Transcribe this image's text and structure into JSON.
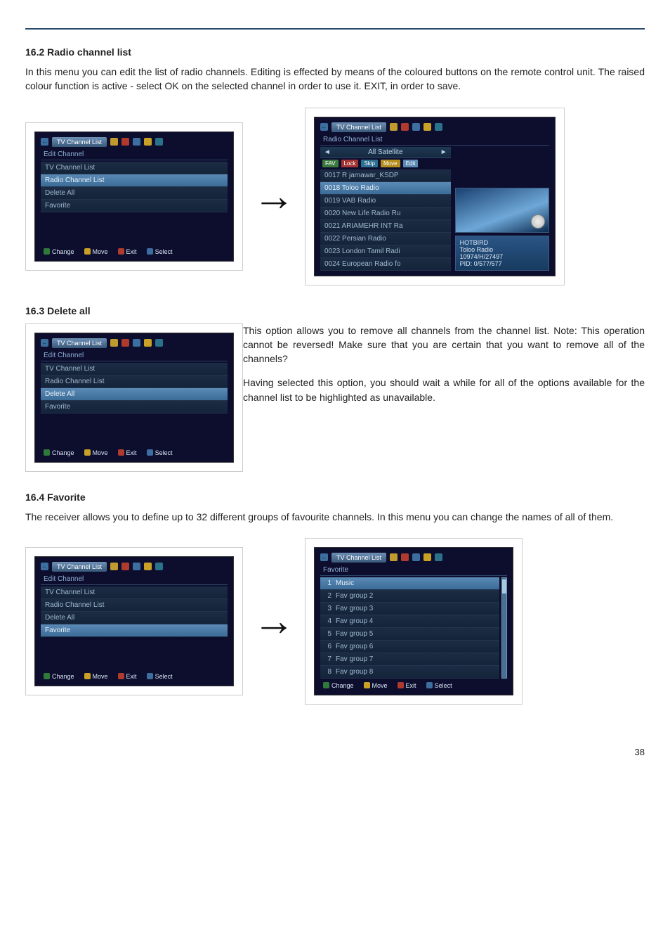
{
  "page_number": 38,
  "sections": {
    "s162": {
      "title": "16.2 Radio channel list",
      "body": "In this menu you can edit the list of radio channels. Editing is effected by means of the coloured buttons on the remote control unit. The raised colour function is active - select OK on the selected channel in order to use it. EXIT, in order to save."
    },
    "s163": {
      "title": "16.3 Delete all",
      "p1": "This option allows you to remove all channels from the channel list. Note: This operation cannot be reversed! Make sure that you are certain that you want to remove all of the channels?",
      "p2": "Having selected this option, you should wait a while for all of the options available for the channel list to be highlighted as unavailable."
    },
    "s164": {
      "title": "16.4 Favorite",
      "body": "The receiver allows you to define up to 32 different groups of favourite channels. In this menu you can change the names of all of them."
    }
  },
  "osd_common": {
    "title_btn": "TV Channel List",
    "header_edit": "Edit Channel",
    "header_radio": "Radio Channel List",
    "header_fav": "Favorite",
    "foot_change": "Change",
    "foot_move": "Move",
    "foot_exit": "Exit",
    "foot_select": "Select"
  },
  "edit_menu_items": {
    "tv": "TV Channel List",
    "radio": "Radio Channel List",
    "del": "Delete All",
    "fav": "Favorite"
  },
  "arrow_symbol": "→",
  "radio_right": {
    "sat": "All Satellite",
    "tags": {
      "fav": "FAV",
      "lock": "Lock",
      "skip": "Skip",
      "move": "Move",
      "edit": "Edit"
    },
    "rows": {
      "r0": "0017 R jamawar_KSDP",
      "r1": "0018 Toloo Radio",
      "r2": "0019 VAB Radio",
      "r3": "0020 New Life Radio Ru",
      "r4": "0021 ARIAMEHR INT Ra",
      "r5": "0022 Persian Radio",
      "r6": "0023 London Tamil Radi",
      "r7": "0024 European Radio fo"
    },
    "info": {
      "l0": "HOTBIRD",
      "l1": "Toloo Radio",
      "l2": "10974/H/27497",
      "l3": "PID: 0/577/577"
    }
  },
  "fav_right": {
    "rows": {
      "r0": "Music",
      "r1": "Fav group 2",
      "r2": "Fav group 3",
      "r3": "Fav group 4",
      "r4": "Fav group 5",
      "r5": "Fav group 6",
      "r6": "Fav group 7",
      "r7": "Fav group 8"
    },
    "nums": {
      "n0": "1",
      "n1": "2",
      "n2": "3",
      "n3": "4",
      "n4": "5",
      "n5": "6",
      "n6": "7",
      "n7": "8"
    }
  }
}
